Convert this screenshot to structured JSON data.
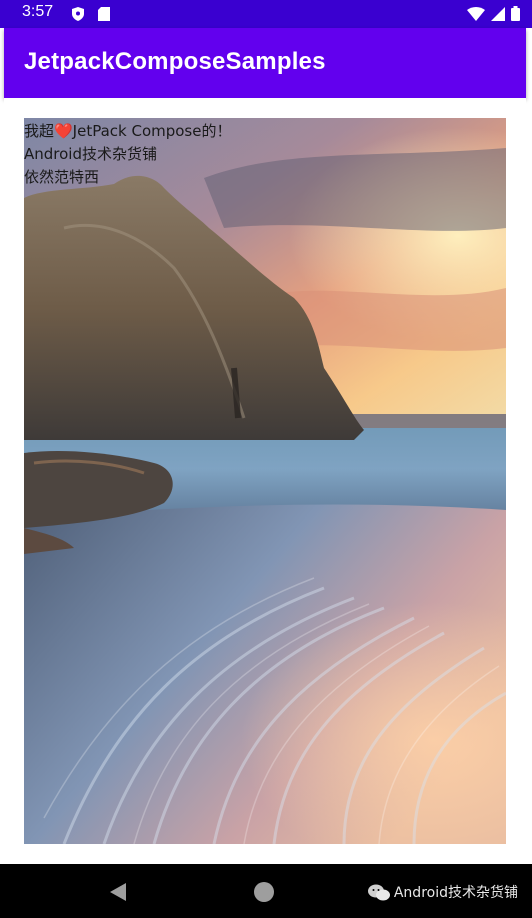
{
  "status_bar": {
    "time": "3:57",
    "icons": [
      "shield-icon",
      "sd-card-icon",
      "wifi-icon",
      "signal-icon",
      "battery-icon"
    ],
    "background": "#3a00d0"
  },
  "app_bar": {
    "title": "JetpackComposeSamples",
    "background": "#6200ee"
  },
  "content": {
    "text_lines": [
      "我超❤️JetPack Compose的！",
      "Android技术杂货铺",
      "依然范特西"
    ],
    "image_description_icon": "beach-rock-sunset-image"
  },
  "nav_bar": {
    "buttons": [
      "back-button",
      "home-button"
    ],
    "watermark": "Android技术杂货铺"
  }
}
